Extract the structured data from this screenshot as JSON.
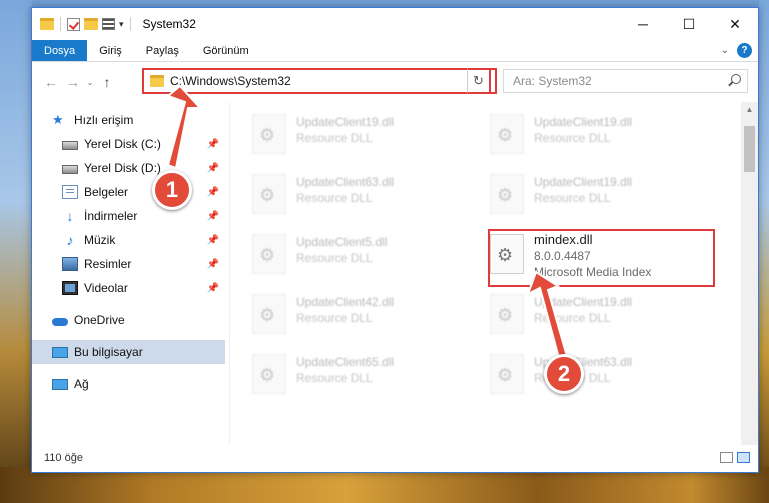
{
  "window": {
    "title": "System32",
    "controls": {
      "minimize": "─",
      "maximize": "☐",
      "close": "✕"
    }
  },
  "qat": {
    "arrow": "▾"
  },
  "ribbon": {
    "tabs": [
      "Dosya",
      "Giriş",
      "Paylaş",
      "Görünüm"
    ],
    "active_tab": "Dosya",
    "collapse": "⌄",
    "help": "?"
  },
  "nav": {
    "back": "←",
    "forward": "→",
    "history": "⌄",
    "up": "↑"
  },
  "address": {
    "path": "C:\\Windows\\System32",
    "dropdown": "⌄",
    "refresh": "↻"
  },
  "search": {
    "placeholder": "Ara: System32"
  },
  "sidebar": {
    "items": [
      {
        "label": "Hızlı erişim",
        "icon": "star-icon"
      },
      {
        "label": "Yerel Disk (C:)",
        "icon": "drive-icon",
        "pinned": true
      },
      {
        "label": "Yerel Disk (D:)",
        "icon": "drive-icon",
        "pinned": true
      },
      {
        "label": "Belgeler",
        "icon": "document-icon",
        "pinned": true
      },
      {
        "label": "İndirmeler",
        "icon": "download-icon",
        "pinned": true
      },
      {
        "label": "Müzik",
        "icon": "music-icon",
        "pinned": true
      },
      {
        "label": "Resimler",
        "icon": "pictures-icon",
        "pinned": true
      },
      {
        "label": "Videolar",
        "icon": "video-icon",
        "pinned": true
      },
      {
        "label": "OneDrive",
        "icon": "cloud-icon"
      },
      {
        "label": "Bu bilgisayar",
        "icon": "computer-icon",
        "selected": true
      },
      {
        "label": "Ağ",
        "icon": "network-icon"
      }
    ],
    "pin_glyph": "📌"
  },
  "files": [
    {
      "name": "UpdateClient19.dll",
      "desc": "Resource DLL"
    },
    {
      "name": "UpdateClient19.dll",
      "desc": "Resource DLL"
    },
    {
      "name": "UpdateClient63.dll",
      "desc": "Resource DLL"
    },
    {
      "name": "UpdateClient19.dll",
      "desc": "Resource DLL"
    },
    {
      "name": "UpdateClient5.dll",
      "desc": "Resource DLL"
    },
    {
      "name": "mindex.dll",
      "version": "8.0.0.4487",
      "desc": "Microsoft Media Index"
    },
    {
      "name": "UpdateClient42.dll",
      "desc": "Resource DLL"
    },
    {
      "name": "UpdateClient19.dll",
      "desc": "Resource DLL"
    },
    {
      "name": "UpdateClient65.dll",
      "desc": "Resource DLL"
    },
    {
      "name": "UpdateClient63.dll",
      "desc": "Resource DLL"
    }
  ],
  "status": {
    "count": "110 öğe"
  },
  "scrollbar": {
    "up": "▲",
    "down": "▼"
  },
  "annotations": {
    "step1": "1",
    "step2": "2"
  },
  "colors": {
    "accent": "#1979ca",
    "highlight": "#e03a3a",
    "badge": "#e24a3a"
  }
}
